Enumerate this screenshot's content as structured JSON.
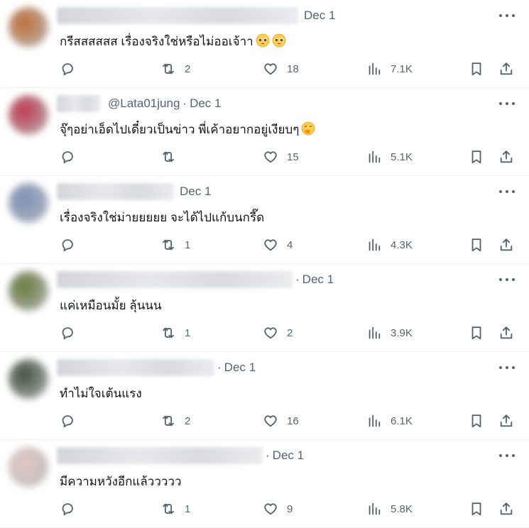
{
  "tweets": [
    {
      "name_width": 340,
      "handle": "",
      "date": "Dec 1",
      "show_dot": false,
      "text": "กรีสสสสสส เรื่องจริงใช่หรือไม่ออเจ้าา",
      "emoji": [
        "pleading",
        "pleading"
      ],
      "replies": "",
      "retweets": "2",
      "likes": "18",
      "views": "7.1K",
      "avatar_color": "#c0703a"
    },
    {
      "name_width": 62,
      "handle": "@Lata01jung",
      "date": "Dec 1",
      "show_dot": true,
      "text": "จุ๊ๆอย่าเอ็ดไปเดี๋ยวเป็นข่าว พี่เค้าอยากอยู่เงียบๆ",
      "emoji": [
        "hand-over-mouth"
      ],
      "replies": "",
      "retweets": "",
      "likes": "15",
      "views": "5.1K",
      "avatar_color": "#c0394e"
    },
    {
      "name_width": 165,
      "handle": "",
      "date": "Dec 1",
      "show_dot": false,
      "text": "เรื่องจริงใช่ม่ายยยยย จะได้ไปแก้บนกรี๊ด",
      "emoji": [],
      "replies": "",
      "retweets": "1",
      "likes": "4",
      "views": "4.3K",
      "avatar_color": "#7d90b5"
    },
    {
      "name_width": 332,
      "handle": "",
      "date": "Dec 1",
      "show_dot": true,
      "text": "แค่เหมือนมั้ย ลุ้นนน",
      "emoji": [],
      "replies": "",
      "retweets": "1",
      "likes": "2",
      "views": "3.9K",
      "avatar_color": "#6b7a3e"
    },
    {
      "name_width": 222,
      "handle": "",
      "date": "Dec 1",
      "show_dot": true,
      "text": "ทำไม่ใจเต้นแรง",
      "emoji": [],
      "replies": "",
      "retweets": "2",
      "likes": "16",
      "views": "6.1K",
      "avatar_color": "#44513e"
    },
    {
      "name_width": 290,
      "handle": "",
      "date": "Dec 1",
      "show_dot": true,
      "text": "มีความหวังอีกแล้ววววว",
      "emoji": [],
      "replies": "",
      "retweets": "1",
      "likes": "9",
      "views": "5.8K",
      "avatar_color": "#e3c7c2"
    }
  ]
}
